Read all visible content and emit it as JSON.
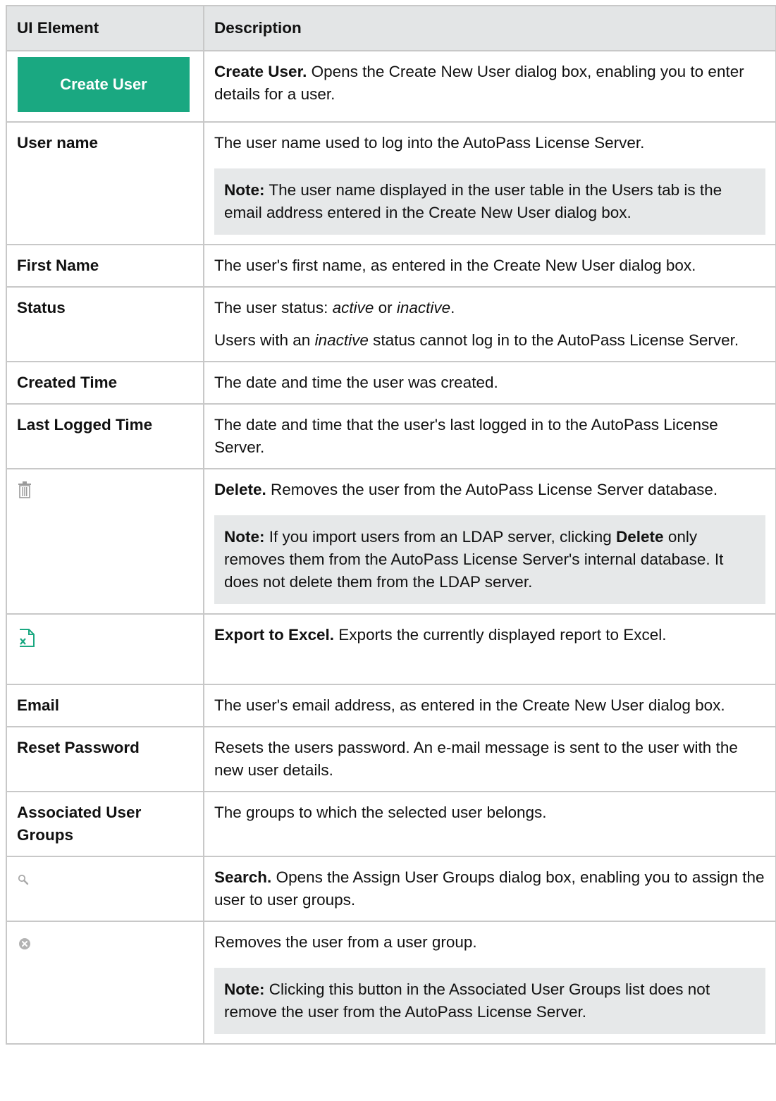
{
  "header": {
    "col_element": "UI Element",
    "col_description": "Description"
  },
  "rows": {
    "create_user": {
      "button_label": "Create User",
      "desc_bold": "Create User.",
      "desc_text": " Opens the Create New User dialog box, enabling you to enter details for a user."
    },
    "user_name": {
      "element": "User name",
      "desc": "The user name used to log into the AutoPass License Server.",
      "note_label": "Note:",
      "note_text": " The user name displayed in the user table in the Users tab is the email address entered in the Create New User dialog box."
    },
    "first_name": {
      "element": "First Name",
      "desc": "The user's first name, as entered in the Create New User dialog box."
    },
    "status": {
      "element": "Status",
      "desc_a": "The user status: ",
      "desc_active": "active",
      "desc_or": " or ",
      "desc_inactive": "inactive",
      "desc_end": ".",
      "desc2_a": "Users with an ",
      "desc2_inactive": "inactive",
      "desc2_b": " status cannot log in to the AutoPass License Server."
    },
    "created_time": {
      "element": "Created Time",
      "desc": "The date and time the user was created."
    },
    "last_logged": {
      "element": "Last Logged Time",
      "desc": "The date and time that the user's last logged in to the AutoPass License Server."
    },
    "delete": {
      "icon": "trash-icon",
      "desc_bold": "Delete.",
      "desc_text": " Removes the user from the AutoPass License Server database.",
      "note_label": "Note:",
      "note_a": " If you import users from an LDAP server, clicking ",
      "note_bold": "Delete",
      "note_b": " only removes them from the AutoPass License Server's internal database. It does not delete them from the LDAP server."
    },
    "export": {
      "icon": "excel-export-icon",
      "desc_bold": "Export to Excel.",
      "desc_text": " Exports the currently displayed report to Excel."
    },
    "email": {
      "element": "Email",
      "desc": "The user's email address, as entered in the Create New User dialog box."
    },
    "reset_password": {
      "element": "Reset Password",
      "desc": "Resets the users password. An e-mail message is sent to the user with the new user details."
    },
    "associated_groups": {
      "element": "Associated User Groups",
      "desc": "The groups to which the selected user belongs."
    },
    "search": {
      "icon": "search-icon",
      "desc_bold": "Search.",
      "desc_text": " Opens the Assign User Groups dialog box, enabling you to assign the user to user groups."
    },
    "remove_group": {
      "icon": "remove-circle-icon",
      "desc": "Removes the user from a user group.",
      "note_label": "Note:",
      "note_text": " Clicking this button in the Associated User Groups list does not remove the user from the AutoPass License Server."
    }
  },
  "colors": {
    "button_green": "#1aa881",
    "header_bg": "#e3e5e6",
    "note_bg": "#e6e8e9",
    "border": "#c8c8c8"
  }
}
